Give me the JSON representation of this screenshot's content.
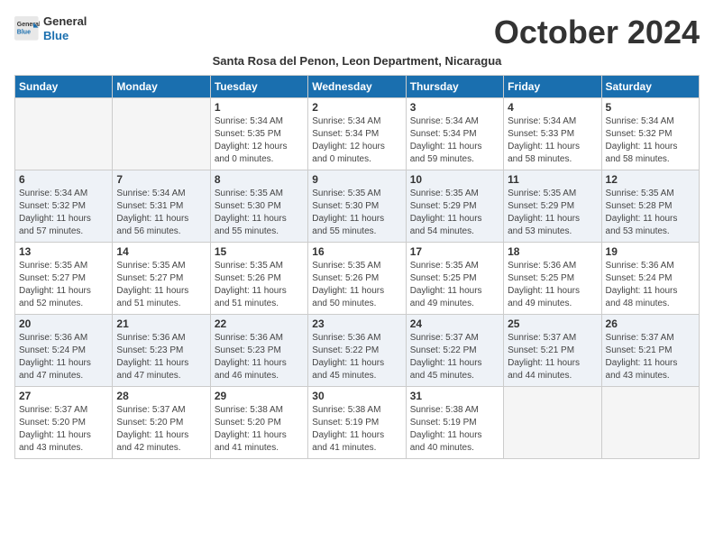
{
  "header": {
    "logo_general": "General",
    "logo_blue": "Blue",
    "month_title": "October 2024",
    "subtitle": "Santa Rosa del Penon, Leon Department, Nicaragua"
  },
  "days_of_week": [
    "Sunday",
    "Monday",
    "Tuesday",
    "Wednesday",
    "Thursday",
    "Friday",
    "Saturday"
  ],
  "weeks": [
    [
      {
        "day": "",
        "info": ""
      },
      {
        "day": "",
        "info": ""
      },
      {
        "day": "1",
        "info": "Sunrise: 5:34 AM\nSunset: 5:35 PM\nDaylight: 12 hours\nand 0 minutes."
      },
      {
        "day": "2",
        "info": "Sunrise: 5:34 AM\nSunset: 5:34 PM\nDaylight: 12 hours\nand 0 minutes."
      },
      {
        "day": "3",
        "info": "Sunrise: 5:34 AM\nSunset: 5:34 PM\nDaylight: 11 hours\nand 59 minutes."
      },
      {
        "day": "4",
        "info": "Sunrise: 5:34 AM\nSunset: 5:33 PM\nDaylight: 11 hours\nand 58 minutes."
      },
      {
        "day": "5",
        "info": "Sunrise: 5:34 AM\nSunset: 5:32 PM\nDaylight: 11 hours\nand 58 minutes."
      }
    ],
    [
      {
        "day": "6",
        "info": "Sunrise: 5:34 AM\nSunset: 5:32 PM\nDaylight: 11 hours\nand 57 minutes."
      },
      {
        "day": "7",
        "info": "Sunrise: 5:34 AM\nSunset: 5:31 PM\nDaylight: 11 hours\nand 56 minutes."
      },
      {
        "day": "8",
        "info": "Sunrise: 5:35 AM\nSunset: 5:30 PM\nDaylight: 11 hours\nand 55 minutes."
      },
      {
        "day": "9",
        "info": "Sunrise: 5:35 AM\nSunset: 5:30 PM\nDaylight: 11 hours\nand 55 minutes."
      },
      {
        "day": "10",
        "info": "Sunrise: 5:35 AM\nSunset: 5:29 PM\nDaylight: 11 hours\nand 54 minutes."
      },
      {
        "day": "11",
        "info": "Sunrise: 5:35 AM\nSunset: 5:29 PM\nDaylight: 11 hours\nand 53 minutes."
      },
      {
        "day": "12",
        "info": "Sunrise: 5:35 AM\nSunset: 5:28 PM\nDaylight: 11 hours\nand 53 minutes."
      }
    ],
    [
      {
        "day": "13",
        "info": "Sunrise: 5:35 AM\nSunset: 5:27 PM\nDaylight: 11 hours\nand 52 minutes."
      },
      {
        "day": "14",
        "info": "Sunrise: 5:35 AM\nSunset: 5:27 PM\nDaylight: 11 hours\nand 51 minutes."
      },
      {
        "day": "15",
        "info": "Sunrise: 5:35 AM\nSunset: 5:26 PM\nDaylight: 11 hours\nand 51 minutes."
      },
      {
        "day": "16",
        "info": "Sunrise: 5:35 AM\nSunset: 5:26 PM\nDaylight: 11 hours\nand 50 minutes."
      },
      {
        "day": "17",
        "info": "Sunrise: 5:35 AM\nSunset: 5:25 PM\nDaylight: 11 hours\nand 49 minutes."
      },
      {
        "day": "18",
        "info": "Sunrise: 5:36 AM\nSunset: 5:25 PM\nDaylight: 11 hours\nand 49 minutes."
      },
      {
        "day": "19",
        "info": "Sunrise: 5:36 AM\nSunset: 5:24 PM\nDaylight: 11 hours\nand 48 minutes."
      }
    ],
    [
      {
        "day": "20",
        "info": "Sunrise: 5:36 AM\nSunset: 5:24 PM\nDaylight: 11 hours\nand 47 minutes."
      },
      {
        "day": "21",
        "info": "Sunrise: 5:36 AM\nSunset: 5:23 PM\nDaylight: 11 hours\nand 47 minutes."
      },
      {
        "day": "22",
        "info": "Sunrise: 5:36 AM\nSunset: 5:23 PM\nDaylight: 11 hours\nand 46 minutes."
      },
      {
        "day": "23",
        "info": "Sunrise: 5:36 AM\nSunset: 5:22 PM\nDaylight: 11 hours\nand 45 minutes."
      },
      {
        "day": "24",
        "info": "Sunrise: 5:37 AM\nSunset: 5:22 PM\nDaylight: 11 hours\nand 45 minutes."
      },
      {
        "day": "25",
        "info": "Sunrise: 5:37 AM\nSunset: 5:21 PM\nDaylight: 11 hours\nand 44 minutes."
      },
      {
        "day": "26",
        "info": "Sunrise: 5:37 AM\nSunset: 5:21 PM\nDaylight: 11 hours\nand 43 minutes."
      }
    ],
    [
      {
        "day": "27",
        "info": "Sunrise: 5:37 AM\nSunset: 5:20 PM\nDaylight: 11 hours\nand 43 minutes."
      },
      {
        "day": "28",
        "info": "Sunrise: 5:37 AM\nSunset: 5:20 PM\nDaylight: 11 hours\nand 42 minutes."
      },
      {
        "day": "29",
        "info": "Sunrise: 5:38 AM\nSunset: 5:20 PM\nDaylight: 11 hours\nand 41 minutes."
      },
      {
        "day": "30",
        "info": "Sunrise: 5:38 AM\nSunset: 5:19 PM\nDaylight: 11 hours\nand 41 minutes."
      },
      {
        "day": "31",
        "info": "Sunrise: 5:38 AM\nSunset: 5:19 PM\nDaylight: 11 hours\nand 40 minutes."
      },
      {
        "day": "",
        "info": ""
      },
      {
        "day": "",
        "info": ""
      }
    ]
  ]
}
